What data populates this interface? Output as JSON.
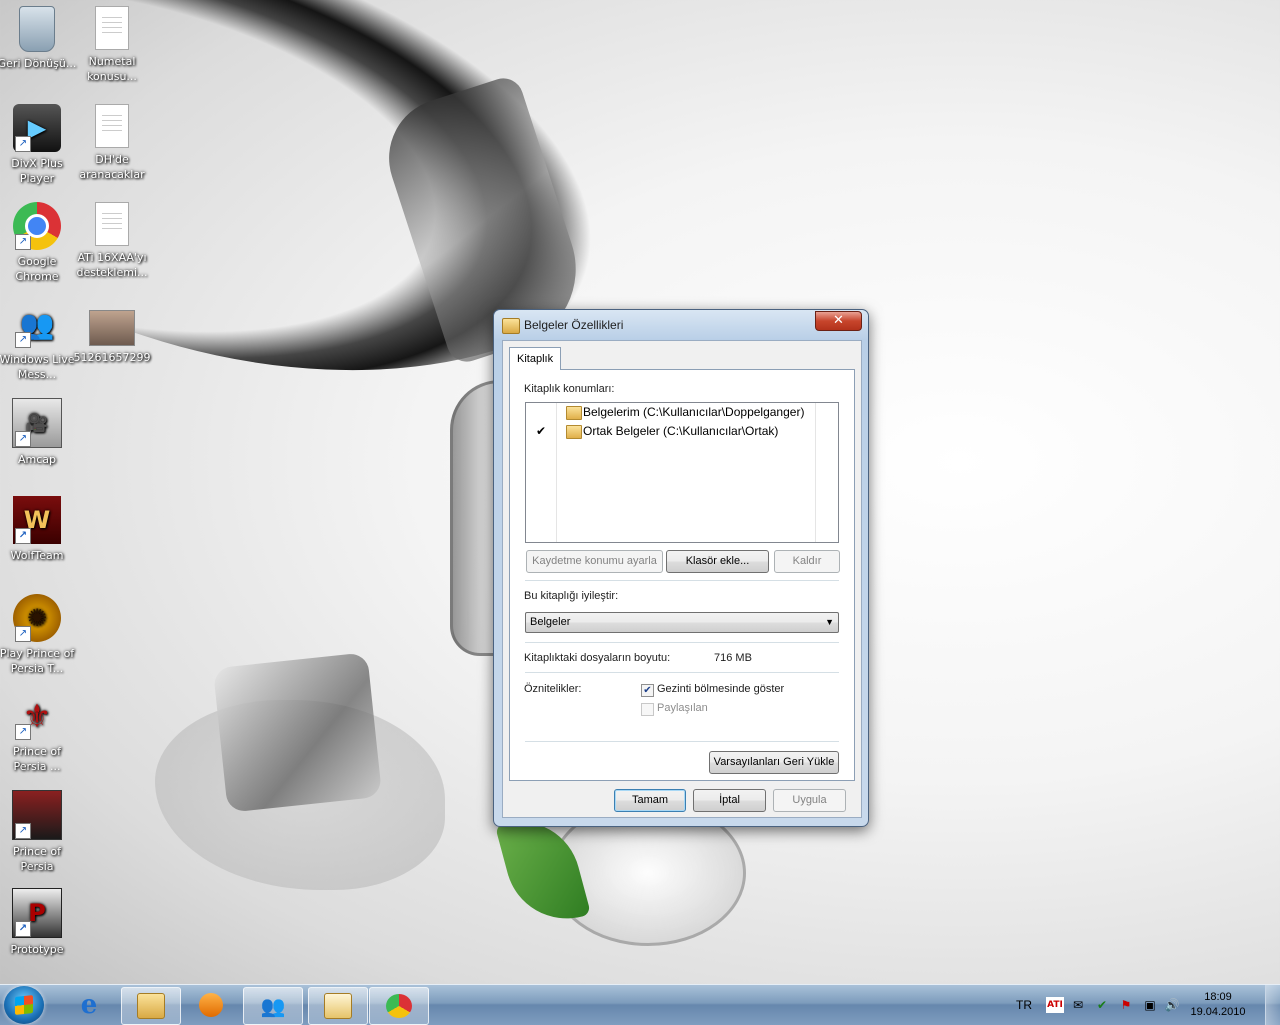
{
  "desktop": {
    "icons": [
      {
        "label": "Geri Dönüşü...",
        "icon": "recycle-bin-icon"
      },
      {
        "label": "Numetal konusu...",
        "icon": "text-document-icon"
      },
      {
        "label": "DivX Plus Player",
        "icon": "divx-player-icon"
      },
      {
        "label": "DH'de aranacaklar",
        "icon": "text-document-icon"
      },
      {
        "label": "Google Chrome",
        "icon": "chrome-icon"
      },
      {
        "label": "ATi 16XAA'yı desteklemi...",
        "icon": "text-document-icon"
      },
      {
        "label": "Windows Live Mess...",
        "icon": "messenger-icon"
      },
      {
        "label": "51261657299",
        "icon": "photo-icon"
      },
      {
        "label": "Amcap",
        "icon": "amcap-icon"
      },
      {
        "label": "WolfTeam",
        "icon": "wolfteam-icon"
      },
      {
        "label": "Play Prince of Persia T...",
        "icon": "prince-of-persia-icon"
      },
      {
        "label": "Prince of Persia ...",
        "icon": "prince-of-persia-icon"
      },
      {
        "label": "Prince of Persia",
        "icon": "prince-of-persia-icon"
      },
      {
        "label": "Prototype",
        "icon": "prototype-icon"
      }
    ]
  },
  "dialog": {
    "title": "Belgeler Özellikleri",
    "close_label": "✕",
    "tab_label": "Kitaplık",
    "locations_label": "Kitaplık konumları:",
    "locations": [
      {
        "check": "",
        "text": "Belgelerim (C:\\Kullanıcılar\\Doppelganger)"
      },
      {
        "check": "✔",
        "text": "Ortak Belgeler (C:\\Kullanıcılar\\Ortak)"
      }
    ],
    "set_save_location_label": "Kaydetme konumu ayarla",
    "add_folder_label": "Klasör ekle...",
    "remove_label": "Kaldır",
    "optimize_label": "Bu kitaplığı iyileştir:",
    "optimize_value": "Belgeler",
    "size_label": "Kitaplıktaki dosyaların boyutu:",
    "size_value": "716 MB",
    "attributes_label": "Öznitelikler:",
    "show_in_nav_label": "Gezinti bölmesinde göster",
    "show_in_nav_checked": "✔",
    "shared_label": "Paylaşılan",
    "restore_defaults_label": "Varsayılanları Geri Yükle",
    "ok_label": "Tamam",
    "cancel_label": "İptal",
    "apply_label": "Uygula"
  },
  "taskbar": {
    "language": "TR",
    "ati_label": "ATI",
    "time": "18:09",
    "date": "19.04.2010"
  }
}
